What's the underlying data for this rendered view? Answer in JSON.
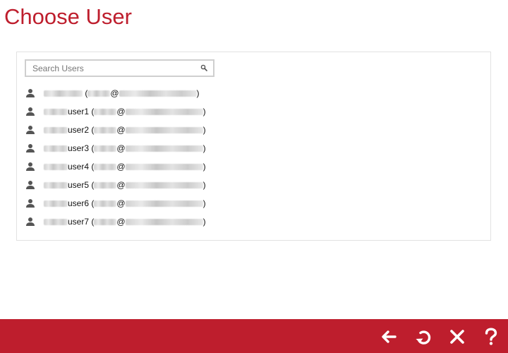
{
  "header": {
    "title": "Choose User"
  },
  "search": {
    "placeholder": "Search Users",
    "value": ""
  },
  "users": [
    {
      "name_suffix": "",
      "open_paren": "(",
      "at": "@",
      "close_paren": ")"
    },
    {
      "name_suffix": "user1",
      "open_paren": "(",
      "at": "@",
      "close_paren": ")"
    },
    {
      "name_suffix": "user2",
      "open_paren": "(",
      "at": "@",
      "close_paren": ")"
    },
    {
      "name_suffix": "user3",
      "open_paren": "(",
      "at": "@",
      "close_paren": ")"
    },
    {
      "name_suffix": "user4",
      "open_paren": "(",
      "at": "@",
      "close_paren": ")"
    },
    {
      "name_suffix": "user5",
      "open_paren": "(",
      "at": "@",
      "close_paren": ")"
    },
    {
      "name_suffix": "user6",
      "open_paren": "(",
      "at": "@",
      "close_paren": ")"
    },
    {
      "name_suffix": "user7",
      "open_paren": "(",
      "at": "@",
      "close_paren": ")"
    }
  ],
  "icons": {
    "user": "user-icon",
    "search": "search-icon",
    "back": "arrow-left-icon",
    "undo": "undo-icon",
    "close": "close-icon",
    "help": "help-icon"
  },
  "colors": {
    "brand": "#be1e2d",
    "icon_gray": "#555555",
    "border": "#e2e2e2"
  }
}
